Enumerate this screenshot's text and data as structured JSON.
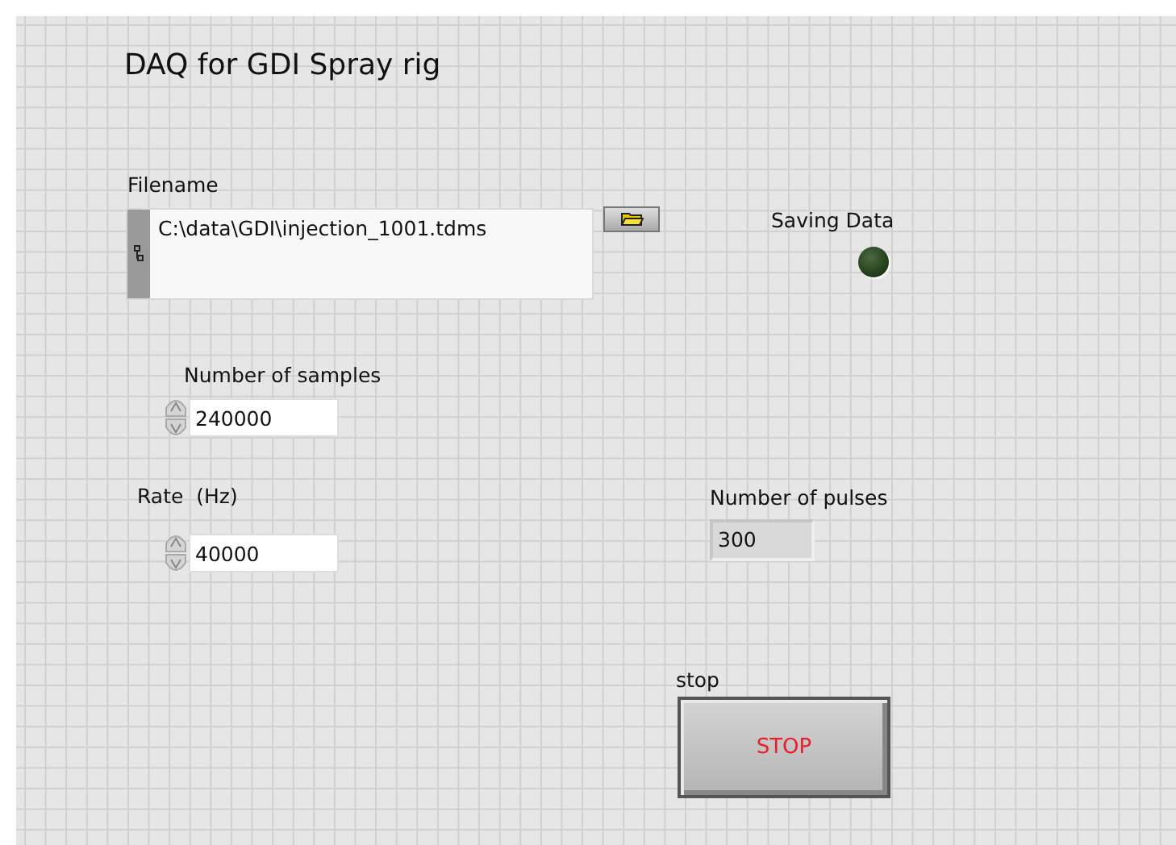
{
  "title": "DAQ for GDI Spray rig",
  "filename": {
    "label": "Filename",
    "value": "C:\\data\\GDI\\injection_1001.tdms"
  },
  "saving_data": {
    "label": "Saving Data",
    "on": false
  },
  "number_of_samples": {
    "label": "Number of samples",
    "value": "240000"
  },
  "rate": {
    "label": "Rate  (Hz)",
    "value": "40000"
  },
  "number_of_pulses": {
    "label": "Number of pulses",
    "value": "300"
  },
  "stop": {
    "label": "stop",
    "text": "STOP"
  }
}
